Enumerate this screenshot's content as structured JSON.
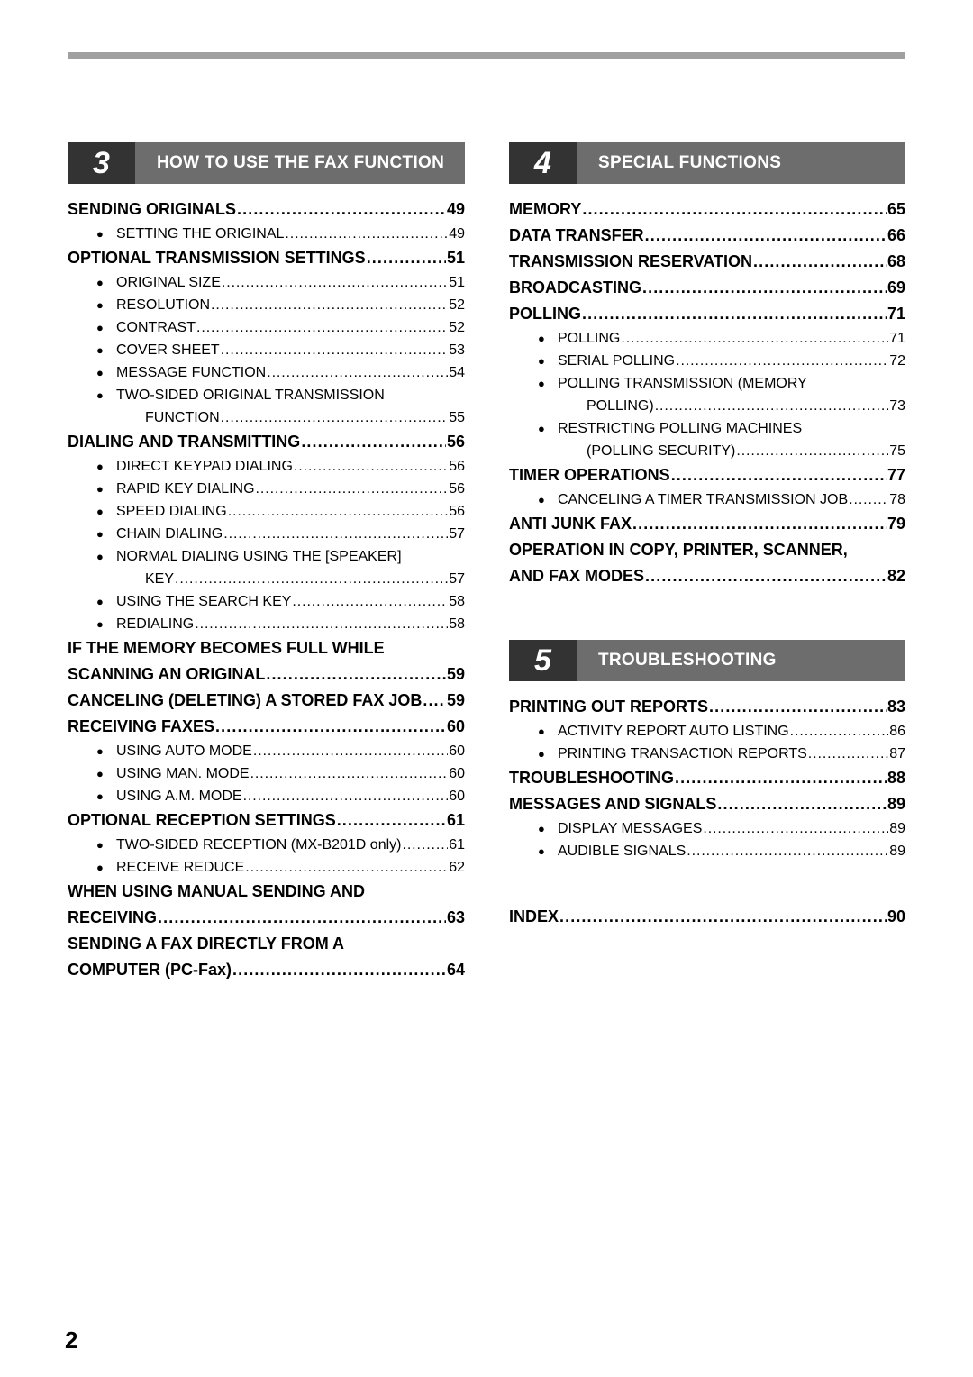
{
  "page": {
    "folio": "2",
    "top_rule_color": "#a0a0a0",
    "chapter_num_bg": "#333333",
    "chapter_bar_bg": "#6d6d6d"
  },
  "left_column": {
    "chapter": {
      "number": "3",
      "title": "HOW TO USE THE FAX FUNCTION"
    },
    "entries": [
      {
        "level": "main",
        "label": "SENDING ORIGINALS",
        "page": "49"
      },
      {
        "level": "sub",
        "label": "SETTING THE ORIGINAL",
        "page": "49"
      },
      {
        "level": "main",
        "label": "OPTIONAL TRANSMISSION SETTINGS",
        "page": "51"
      },
      {
        "level": "sub",
        "label": "ORIGINAL SIZE",
        "page": "51"
      },
      {
        "level": "sub",
        "label": "RESOLUTION",
        "page": "52"
      },
      {
        "level": "sub",
        "label": "CONTRAST",
        "page": "52"
      },
      {
        "level": "sub",
        "label": "COVER SHEET",
        "page": "53"
      },
      {
        "level": "sub",
        "label": "MESSAGE FUNCTION",
        "page": "54"
      },
      {
        "level": "sub",
        "label": "TWO-SIDED ORIGINAL TRANSMISSION",
        "page": ""
      },
      {
        "level": "sub-cont",
        "label": "FUNCTION",
        "page": "55"
      },
      {
        "level": "main",
        "label": "DIALING AND TRANSMITTING",
        "page": "56"
      },
      {
        "level": "sub",
        "label": "DIRECT KEYPAD DIALING",
        "page": "56"
      },
      {
        "level": "sub",
        "label": "RAPID KEY DIALING",
        "page": "56"
      },
      {
        "level": "sub",
        "label": "SPEED DIALING",
        "page": "56"
      },
      {
        "level": "sub",
        "label": "CHAIN DIALING",
        "page": "57"
      },
      {
        "level": "sub",
        "label": "NORMAL DIALING USING THE [SPEAKER]",
        "page": ""
      },
      {
        "level": "sub-cont",
        "label": "KEY",
        "page": "57"
      },
      {
        "level": "sub",
        "label": "USING THE SEARCH KEY",
        "page": "58"
      },
      {
        "level": "sub",
        "label": "REDIALING",
        "page": "58"
      },
      {
        "level": "main-cont",
        "label": "IF THE MEMORY BECOMES FULL WHILE",
        "page": ""
      },
      {
        "level": "main",
        "label": "SCANNING AN ORIGINAL",
        "page": "59"
      },
      {
        "level": "main",
        "label": "CANCELING (DELETING) A STORED FAX JOB",
        "page": "59"
      },
      {
        "level": "main",
        "label": "RECEIVING FAXES",
        "page": "60"
      },
      {
        "level": "sub",
        "label": "USING AUTO MODE",
        "page": "60"
      },
      {
        "level": "sub",
        "label": "USING MAN. MODE",
        "page": "60"
      },
      {
        "level": "sub",
        "label": "USING A.M. MODE",
        "page": "60"
      },
      {
        "level": "main",
        "label": "OPTIONAL RECEPTION SETTINGS",
        "page": "61"
      },
      {
        "level": "sub",
        "label": "TWO-SIDED RECEPTION (MX-B201D only)",
        "page": "61"
      },
      {
        "level": "sub",
        "label": "RECEIVE REDUCE",
        "page": "62"
      },
      {
        "level": "main-cont",
        "label": "WHEN USING MANUAL SENDING AND",
        "page": ""
      },
      {
        "level": "main",
        "label": "RECEIVING",
        "page": "63"
      },
      {
        "level": "main-cont",
        "label": "SENDING A FAX DIRECTLY FROM A",
        "page": ""
      },
      {
        "level": "main",
        "label": "COMPUTER (PC-Fax)",
        "page": "64"
      }
    ]
  },
  "right_column": {
    "chapter_4": {
      "number": "4",
      "title": "SPECIAL FUNCTIONS"
    },
    "entries_4": [
      {
        "level": "main",
        "label": "MEMORY",
        "page": "65"
      },
      {
        "level": "main",
        "label": "DATA TRANSFER",
        "page": "66"
      },
      {
        "level": "main",
        "label": "TRANSMISSION RESERVATION",
        "page": "68"
      },
      {
        "level": "main",
        "label": "BROADCASTING",
        "page": "69"
      },
      {
        "level": "main",
        "label": "POLLING",
        "page": "71"
      },
      {
        "level": "sub",
        "label": "POLLING",
        "page": "71"
      },
      {
        "level": "sub",
        "label": "SERIAL POLLING",
        "page": "72"
      },
      {
        "level": "sub",
        "label": "POLLING TRANSMISSION (MEMORY",
        "page": ""
      },
      {
        "level": "sub-cont",
        "label": "POLLING)",
        "page": "73"
      },
      {
        "level": "sub",
        "label": "RESTRICTING POLLING MACHINES",
        "page": ""
      },
      {
        "level": "sub-cont",
        "label": "(POLLING SECURITY)",
        "page": "75"
      },
      {
        "level": "main",
        "label": "TIMER OPERATIONS",
        "page": "77"
      },
      {
        "level": "sub",
        "label": "CANCELING A TIMER TRANSMISSION JOB",
        "page": "78"
      },
      {
        "level": "main",
        "label": "ANTI JUNK FAX",
        "page": "79"
      },
      {
        "level": "main-cont",
        "label": "OPERATION IN COPY, PRINTER, SCANNER,",
        "page": ""
      },
      {
        "level": "main",
        "label": "AND FAX MODES",
        "page": "82"
      }
    ],
    "chapter_5": {
      "number": "5",
      "title": "TROUBLESHOOTING"
    },
    "entries_5": [
      {
        "level": "main",
        "label": "PRINTING OUT REPORTS",
        "page": "83"
      },
      {
        "level": "sub",
        "label": "ACTIVITY REPORT AUTO LISTING",
        "page": "86"
      },
      {
        "level": "sub",
        "label": "PRINTING TRANSACTION REPORTS",
        "page": "87"
      },
      {
        "level": "main",
        "label": "TROUBLESHOOTING",
        "page": "88"
      },
      {
        "level": "main",
        "label": "MESSAGES AND SIGNALS",
        "page": "89"
      },
      {
        "level": "sub",
        "label": "DISPLAY MESSAGES",
        "page": "89"
      },
      {
        "level": "sub",
        "label": "AUDIBLE SIGNALS",
        "page": "89"
      }
    ],
    "entries_index": [
      {
        "level": "main",
        "label": "INDEX",
        "page": "90"
      }
    ]
  },
  "icons": {
    "bullet": "●",
    "leader": "…"
  }
}
